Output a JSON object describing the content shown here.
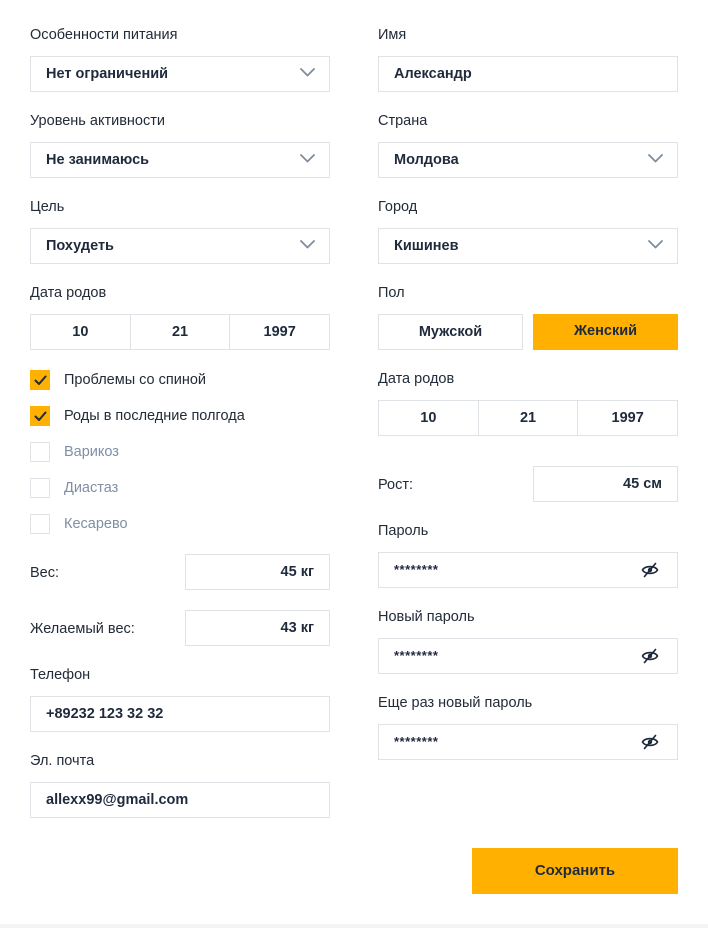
{
  "left": {
    "diet": {
      "label": "Особенности питания",
      "value": "Нет ограничений"
    },
    "activity": {
      "label": "Уровень активности",
      "value": "Не занимаюсь"
    },
    "goal": {
      "label": "Цель",
      "value": "Похудеть"
    },
    "birth": {
      "label": "Дата родов",
      "day": "10",
      "month": "21",
      "year": "1997"
    },
    "checkboxes": [
      {
        "label": "Проблемы со спиной",
        "checked": true
      },
      {
        "label": "Роды в последние полгода",
        "checked": true
      },
      {
        "label": "Варикоз",
        "checked": false
      },
      {
        "label": "Диастаз",
        "checked": false
      },
      {
        "label": "Кесарево",
        "checked": false
      }
    ],
    "weight": {
      "label": "Вес:",
      "value": "45 кг"
    },
    "target_weight": {
      "label": "Желаемый вес:",
      "value": "43 кг"
    },
    "phone": {
      "label": "Телефон",
      "value": "+89232 123 32 32"
    },
    "email": {
      "label": "Эл. почта",
      "value": "allexx99@gmail.com"
    }
  },
  "right": {
    "name": {
      "label": "Имя",
      "value": "Александр"
    },
    "country": {
      "label": "Страна",
      "value": "Молдова"
    },
    "city": {
      "label": "Город",
      "value": "Кишинев"
    },
    "gender": {
      "label": "Пол",
      "male": "Мужской",
      "female": "Женский",
      "selected": "female"
    },
    "birth": {
      "label": "Дата родов",
      "day": "10",
      "month": "21",
      "year": "1997"
    },
    "height": {
      "label": "Рост:",
      "value": "45 см"
    },
    "password": {
      "label": "Пароль",
      "value": "********"
    },
    "new_password": {
      "label": "Новый пароль",
      "value": "********"
    },
    "repeat_password": {
      "label": "Еще раз новый пароль",
      "value": "********"
    }
  },
  "save_label": "Сохранить",
  "colors": {
    "accent": "#ffb000",
    "border": "#dfe3e8",
    "text": "#1f2a3c",
    "muted": "#7e8fa6"
  },
  "icons": {
    "select": "chevron-down-icon",
    "checkbox": "check-icon",
    "password": "eye-slash-icon"
  }
}
